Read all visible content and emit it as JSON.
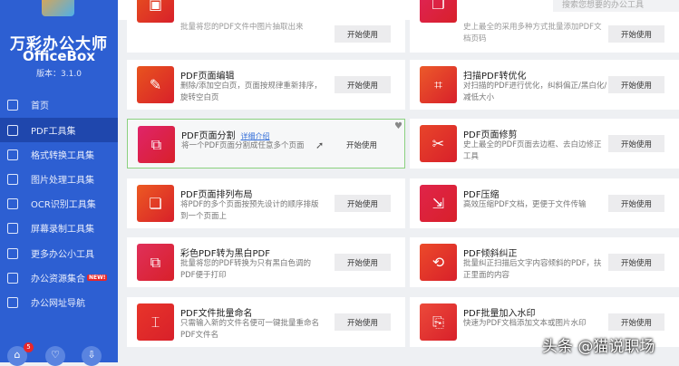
{
  "app": {
    "title": "万彩办公大师",
    "subtitle": "OfficeBox",
    "version": "版本：3.1.0"
  },
  "sidebar": {
    "items": [
      {
        "label": "首页",
        "icon": "home-icon"
      },
      {
        "label": "PDF工具集",
        "icon": "pdf-icon",
        "active": true
      },
      {
        "label": "格式转换工具集",
        "icon": "convert-icon"
      },
      {
        "label": "图片处理工具集",
        "icon": "image-icon"
      },
      {
        "label": "OCR识别工具集",
        "icon": "ocr-icon"
      },
      {
        "label": "屏幕录制工具集",
        "icon": "monitor-icon"
      },
      {
        "label": "更多办公小工具",
        "icon": "grid-icon"
      },
      {
        "label": "办公资源集合",
        "icon": "briefcase-icon",
        "badge": "NEW!"
      },
      {
        "label": "办公网址导航",
        "icon": "browser-icon"
      }
    ],
    "bottom_badge": "5"
  },
  "search": {
    "placeholder": "搜索您想要的办公工具"
  },
  "button_label": "开始使用",
  "detail_link": "详细介绍",
  "cards": [
    {
      "title": "",
      "desc": "批量将您的PDF文件中图片抽取出来",
      "color": "#e8541e"
    },
    {
      "title": "",
      "desc": "史上最全的采用多种方式批量添加PDF文档页码",
      "color": "#e0245a"
    },
    {
      "title": "PDF页面编辑",
      "desc": "删除/添加空白页，页面按规律重新排序，旋转空白页",
      "color": "#e8541e"
    },
    {
      "title": "扫描PDF转优化",
      "desc": "对扫描的PDF进行优化，纠斜偏正/黑白化/减低大小",
      "color": "#ec5a2a"
    },
    {
      "title": "PDF页面分割",
      "desc": "将一个PDF页面分割成任意多个页面",
      "color": "#e0246a"
    },
    {
      "title": "PDF页面修剪",
      "desc": "史上最全的PDF页面去边框、去白边修正工具",
      "color": "#e8452a"
    },
    {
      "title": "PDF页面排列布局",
      "desc": "将PDF的多个页面按预先设计的顺序排版到一个页面上",
      "color": "#ec5a22"
    },
    {
      "title": "PDF压缩",
      "desc": "高效压缩PDF文档，更便于文件传输",
      "color": "#e0244a"
    },
    {
      "title": "彩色PDF转为黑白PDF",
      "desc": "批量将您的PDF转换为只有黑白色调的PDF便于打印",
      "color": "#e0305a"
    },
    {
      "title": "PDF倾斜纠正",
      "desc": "批量纠正扫描后文字内容倾斜的PDF，扶正里面的内容",
      "color": "#ec4a2a"
    },
    {
      "title": "PDF文件批量命名",
      "desc": "只需输入新的文件名便可一键批量重命名PDF文件名",
      "color": "#e8352a"
    },
    {
      "title": "PDF批量加入水印",
      "desc": "快速为PDF文档添加文本或图片水印",
      "color": "#ec4a3a"
    }
  ],
  "watermark": "头条 @猫说职场"
}
